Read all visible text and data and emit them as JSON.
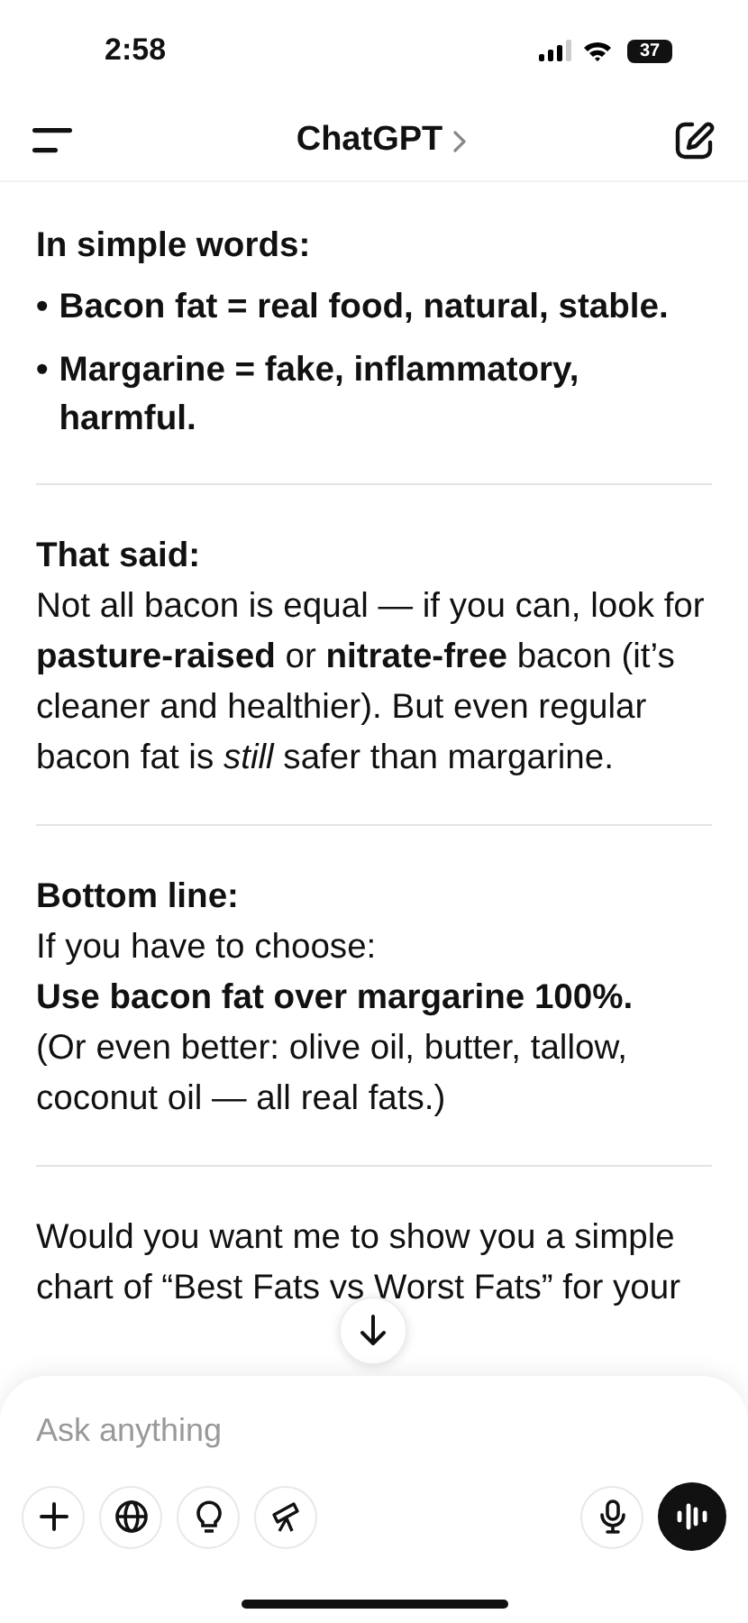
{
  "status_bar": {
    "time": "2:58",
    "battery": "37"
  },
  "header": {
    "title": "ChatGPT"
  },
  "message": [
    {
      "heading": "In simple words:",
      "bullets": [
        {
          "marker": "•",
          "text": "Bacon fat = real food, natural, stable."
        },
        {
          "marker": "•",
          "text": "Margarine = fake, inflammatory, harmful."
        }
      ]
    },
    {
      "heading": "That said:",
      "lines": [
        {
          "kind": "plain",
          "text": "Not all bacon is equal — if you can, look for **pasture-raised** or **nitrate-free** bacon (it’s cleaner and healthier). But even regular bacon fat is *still* safer than margarine."
        }
      ]
    },
    {
      "heading": "Bottom line:",
      "lines": [
        {
          "kind": "plain",
          "text": "If you have to choose:"
        },
        {
          "kind": "strong",
          "text": "Use bacon fat over margarine 100%."
        },
        {
          "kind": "plain",
          "text": "(Or even better: olive oil, butter, tallow, coconut oil — all real fats.)"
        }
      ]
    },
    {
      "lines": [
        {
          "kind": "plain",
          "text": "Would you want me to show you a simple chart of “Best Fats vs Worst Fats” for your"
        }
      ]
    }
  ],
  "composer": {
    "placeholder": "Ask anything"
  }
}
